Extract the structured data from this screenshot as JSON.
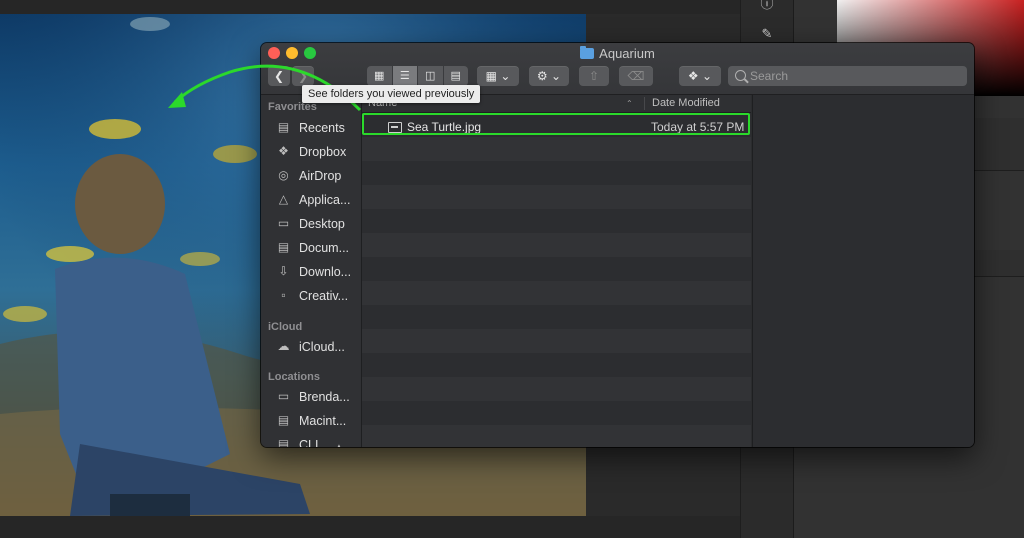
{
  "window": {
    "title": "Aquarium"
  },
  "toolbar": {
    "back_icon": "chevron-left-icon",
    "forward_icon": "chevron-right-icon",
    "view_modes": [
      "icon-view",
      "list-view",
      "column-view",
      "gallery-view"
    ],
    "active_view": "list-view",
    "search_placeholder": "Search",
    "tooltip": "See folders you viewed previously"
  },
  "sidebar": {
    "sections": [
      {
        "heading": "Favorites",
        "items": [
          {
            "label": "Recents",
            "icon": "recents-icon"
          },
          {
            "label": "Dropbox",
            "icon": "dropbox-icon"
          },
          {
            "label": "AirDrop",
            "icon": "airdrop-icon"
          },
          {
            "label": "Applica...",
            "icon": "applications-icon"
          },
          {
            "label": "Desktop",
            "icon": "desktop-icon"
          },
          {
            "label": "Docum...",
            "icon": "documents-icon"
          },
          {
            "label": "Downlo...",
            "icon": "downloads-icon"
          },
          {
            "label": "Creativ...",
            "icon": "folder-icon"
          }
        ]
      },
      {
        "heading": "iCloud",
        "items": [
          {
            "label": "iCloud...",
            "icon": "icloud-icon"
          }
        ]
      },
      {
        "heading": "Locations",
        "items": [
          {
            "label": "Brenda...",
            "icon": "computer-icon"
          },
          {
            "label": "Macint...",
            "icon": "hard-drive-icon"
          },
          {
            "label": "CLI...",
            "icon": "drive-icon"
          }
        ]
      }
    ]
  },
  "list": {
    "columns": {
      "name": "Name",
      "date": "Date Modified"
    },
    "files": [
      {
        "name": "Sea Turtle.jpg",
        "date": "Today at 5:57 PM",
        "icon": "image-file-icon"
      }
    ]
  },
  "colors": {
    "highlight": "#2bd92b",
    "arrow": "#2bd92b"
  }
}
